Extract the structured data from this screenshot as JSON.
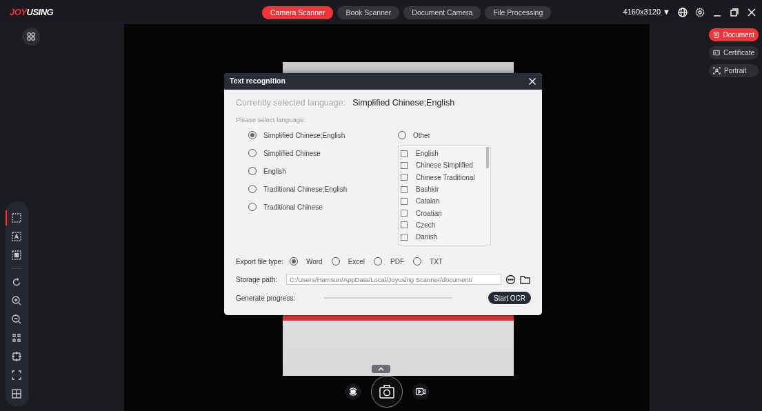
{
  "logo": {
    "accent": "JOY",
    "rest": "USING"
  },
  "tabs": [
    {
      "label": "Camera Scanner",
      "selected": true
    },
    {
      "label": "Book Scanner",
      "selected": false
    },
    {
      "label": "Document Camera",
      "selected": false
    },
    {
      "label": "File Processing",
      "selected": false
    }
  ],
  "resolution": {
    "label": "4160x3120",
    "caret": "▼"
  },
  "region_tools": [
    {
      "kind": "area",
      "selected": true
    },
    {
      "kind": "text",
      "selected": false
    },
    {
      "kind": "image",
      "selected": false
    }
  ],
  "view_tools": [
    {
      "kind": "rotate"
    },
    {
      "kind": "zoom-in"
    },
    {
      "kind": "zoom-out"
    },
    {
      "kind": "fit"
    },
    {
      "kind": "crop"
    },
    {
      "kind": "ocr"
    },
    {
      "kind": "split"
    }
  ],
  "modes": [
    {
      "kind": "document",
      "label": "Document",
      "selected": true
    },
    {
      "kind": "certificate",
      "label": "Certificate",
      "selected": false
    },
    {
      "kind": "portrait",
      "label": "Portrait",
      "selected": false
    }
  ],
  "dialog": {
    "title": "Text recognition",
    "current_label": "Currently selected language:",
    "current_value": "Simplified Chinese;English",
    "prompt": "Please select language:",
    "presets": [
      {
        "label": "Simplified Chinese;English",
        "selected": true
      },
      {
        "label": "Simplified Chinese",
        "selected": false
      },
      {
        "label": "English",
        "selected": false
      },
      {
        "label": "Traditional Chinese;English",
        "selected": false
      },
      {
        "label": "Traditional Chinese",
        "selected": false
      }
    ],
    "other": {
      "label": "Other",
      "selected": false
    },
    "languages": [
      {
        "label": "English",
        "checked": false
      },
      {
        "label": "Chinese Simplified",
        "checked": false
      },
      {
        "label": "Chinese Traditional",
        "checked": false
      },
      {
        "label": "Bashkir",
        "checked": false
      },
      {
        "label": "Catalan",
        "checked": false
      },
      {
        "label": "Croatian",
        "checked": false
      },
      {
        "label": "Czech",
        "checked": false
      },
      {
        "label": "Danish",
        "checked": false
      }
    ],
    "export_label": "Export file type:",
    "export_types": [
      {
        "label": "Word",
        "selected": true
      },
      {
        "label": "Excel",
        "selected": false
      },
      {
        "label": "PDF",
        "selected": false
      },
      {
        "label": "TXT",
        "selected": false
      }
    ],
    "storage_label": "Storage path:",
    "storage_path": "C:/Users/Hamson/AppData/Local/Joyusing Scanner/document/",
    "progress_label": "Generate progress:",
    "progress": {
      "level": 0
    },
    "start_button": "Start OCR"
  }
}
